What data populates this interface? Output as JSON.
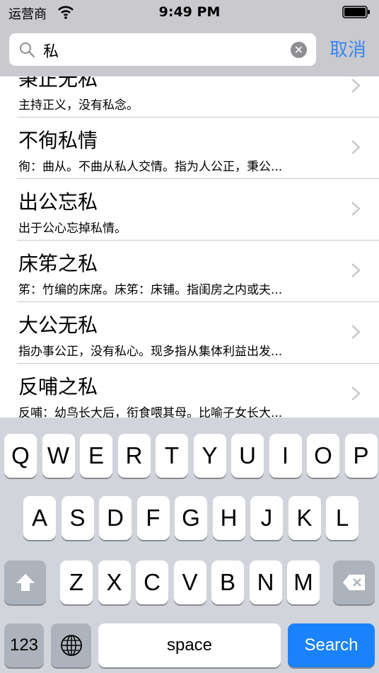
{
  "status_bar": {
    "carrier": "运营商",
    "time": "9:49 PM"
  },
  "search": {
    "query": "私",
    "cancel_label": "取消"
  },
  "results": [
    {
      "title": "秉正无私",
      "desc": "主持正义，没有私念。"
    },
    {
      "title": "不徇私情",
      "desc": "徇：曲从。不曲从私人交情。指为人公正，秉公..."
    },
    {
      "title": "出公忘私",
      "desc": "出于公心忘掉私情。"
    },
    {
      "title": "床笫之私",
      "desc": "笫：竹编的床席。床笫：床铺。指闺房之内或夫..."
    },
    {
      "title": "大公无私",
      "desc": "指办事公正，没有私心。现多指从集体利益出发..."
    },
    {
      "title": "反哺之私",
      "desc": "反哺：幼鸟长大后，衔食喂其母。比喻子女长大..."
    }
  ],
  "keyboard": {
    "row1": [
      "Q",
      "W",
      "E",
      "R",
      "T",
      "Y",
      "U",
      "I",
      "O",
      "P"
    ],
    "row2": [
      "A",
      "S",
      "D",
      "F",
      "G",
      "H",
      "J",
      "K",
      "L"
    ],
    "row3": [
      "Z",
      "X",
      "C",
      "V",
      "B",
      "N",
      "M"
    ],
    "numbers_label": "123",
    "space_label": "space",
    "search_label": "Search"
  }
}
